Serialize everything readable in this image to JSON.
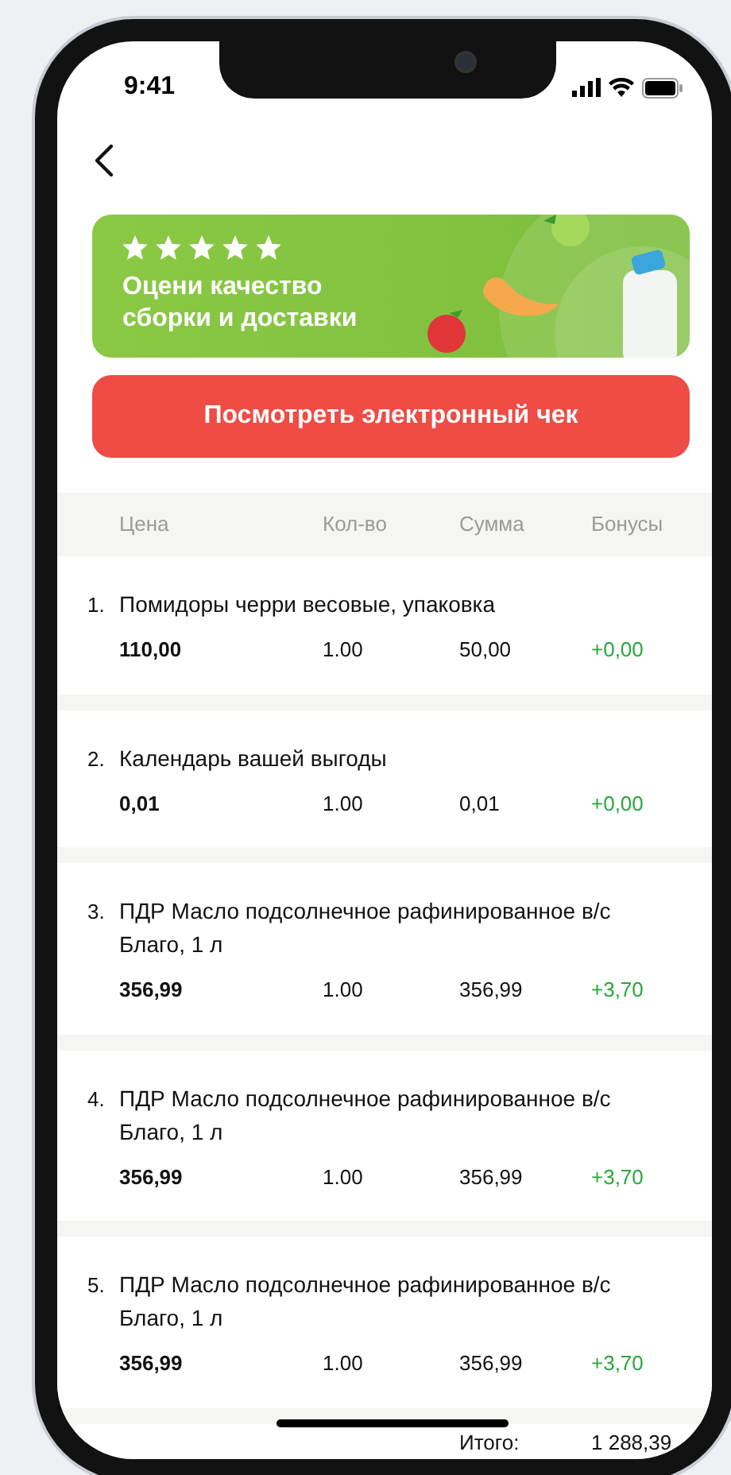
{
  "status_bar": {
    "time": "9:41"
  },
  "banner": {
    "stars": 5,
    "text": "Оцени качество сборки и доставки"
  },
  "receipt_button": {
    "label": "Посмотреть электронный чек"
  },
  "table": {
    "columns": [
      "Цена",
      "Кол-во",
      "Сумма",
      "Бонусы"
    ],
    "rows": [
      {
        "number": "1.",
        "name": "Помидоры черри весовые, упаковка",
        "price": "110,00",
        "qty": "1.00",
        "sum": "50,00",
        "bonus": "+0,00"
      },
      {
        "number": "2.",
        "name": "Календарь вашей выгоды",
        "price": "0,01",
        "qty": "1.00",
        "sum": "0,01",
        "bonus": "+0,00"
      },
      {
        "number": "3.",
        "name": "ПДР Масло подсолнечное рафинированное в/с Благо, 1 л",
        "price": "356,99",
        "qty": "1.00",
        "sum": "356,99",
        "bonus": "+3,70"
      },
      {
        "number": "4.",
        "name": "ПДР Масло подсолнечное рафинированное в/с Благо, 1 л",
        "price": "356,99",
        "qty": "1.00",
        "sum": "356,99",
        "bonus": "+3,70"
      },
      {
        "number": "5.",
        "name": "ПДР Масло подсолнечное рафинированное в/с Благо, 1 л",
        "price": "356,99",
        "qty": "1.00",
        "sum": "356,99",
        "bonus": "+3,70"
      }
    ]
  },
  "total": {
    "label": "Итого:",
    "value": "1 288,39"
  }
}
